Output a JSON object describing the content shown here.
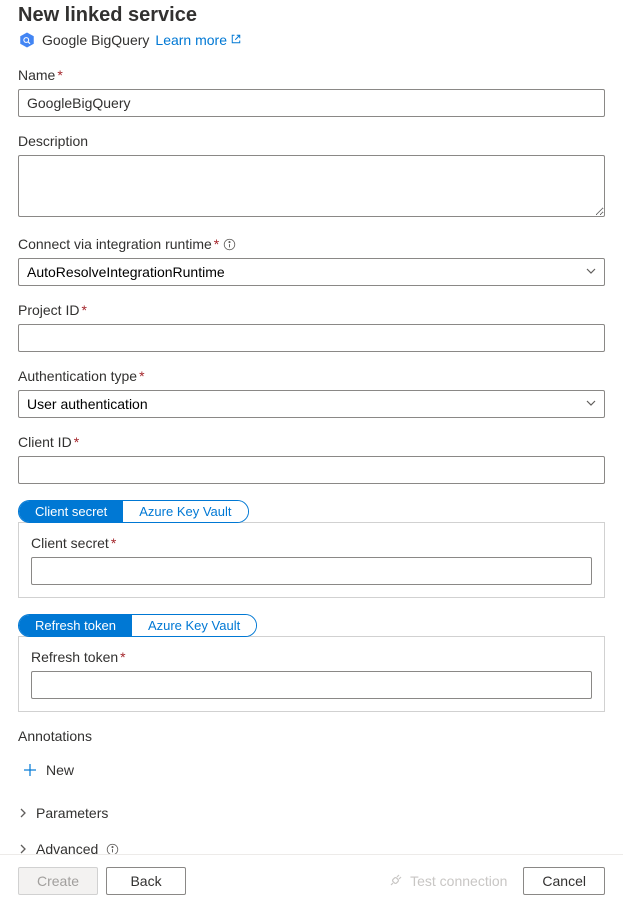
{
  "header": {
    "title": "New linked service",
    "service_name": "Google BigQuery",
    "learn_more": "Learn more"
  },
  "fields": {
    "name": {
      "label": "Name",
      "value": "GoogleBigQuery"
    },
    "description": {
      "label": "Description",
      "value": ""
    },
    "runtime": {
      "label": "Connect via integration runtime",
      "value": "AutoResolveIntegrationRuntime"
    },
    "project_id": {
      "label": "Project ID",
      "value": ""
    },
    "auth_type": {
      "label": "Authentication type",
      "value": "User authentication"
    },
    "client_id": {
      "label": "Client ID",
      "value": ""
    },
    "client_secret": {
      "tab_active": "Client secret",
      "tab_inactive": "Azure Key Vault",
      "label": "Client secret",
      "value": ""
    },
    "refresh_token": {
      "tab_active": "Refresh token",
      "tab_inactive": "Azure Key Vault",
      "label": "Refresh token",
      "value": ""
    }
  },
  "annotations": {
    "label": "Annotations",
    "add_new": "New"
  },
  "sections": {
    "parameters": "Parameters",
    "advanced": "Advanced"
  },
  "footer": {
    "create": "Create",
    "back": "Back",
    "test_connection": "Test connection",
    "cancel": "Cancel"
  }
}
